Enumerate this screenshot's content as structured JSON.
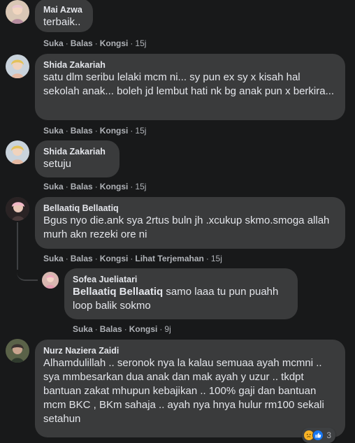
{
  "colors": {
    "background": "#18191a",
    "bubble": "#3a3b3c",
    "text": "#e4e6eb",
    "muted": "#b0b3b8"
  },
  "comments": [
    {
      "author": "Mai Azwa",
      "text": "terbaik..",
      "actions": {
        "like": "Suka",
        "reply": "Balas",
        "share": "Kongsi",
        "time": "15j"
      }
    },
    {
      "author": "Shida Zakariah",
      "text": "satu dlm seribu lelaki mcm ni... sy pun ex sy x kisah hal sekolah anak... boleh jd lembut hati nk bg anak pun x berkira...",
      "actions": {
        "like": "Suka",
        "reply": "Balas",
        "share": "Kongsi",
        "time": "15j"
      }
    },
    {
      "author": "Shida Zakariah",
      "text": "setuju",
      "actions": {
        "like": "Suka",
        "reply": "Balas",
        "share": "Kongsi",
        "time": "15j"
      }
    },
    {
      "author": "Bellaatiq Bellaatiq",
      "text": "Bgus nyo die.ank sya 2rtus buln jh .xcukup skmo.smoga allah murh akn rezeki ore ni",
      "actions": {
        "like": "Suka",
        "reply": "Balas",
        "share": "Kongsi",
        "translate": "Lihat Terjemahan",
        "time": "15j"
      },
      "reply": {
        "author": "Sofea Jueliatari",
        "mention": "Bellaatiq Bellaatiq",
        "text": " samo laaa tu pun puahh loop balik sokmo",
        "actions": {
          "like": "Suka",
          "reply": "Balas",
          "share": "Kongsi",
          "time": "9j"
        }
      }
    },
    {
      "author": "Nurz Naziera Zaidi",
      "text": "Alhamdulillah .. seronok nya la kalau semuaa ayah mcmni .. sya mmbesarkan dua anak dan mak ayah y uzur .. tkdpt bantuan zakat mhupun kebajikan .. 100% gaji dan bantuan mcm BKC , BKm sahaja .. ayah nya hnya hulur rm100 sekali setahun",
      "reactions": {
        "icons": [
          "sad-reaction",
          "like-reaction"
        ],
        "count": "3"
      }
    }
  ]
}
